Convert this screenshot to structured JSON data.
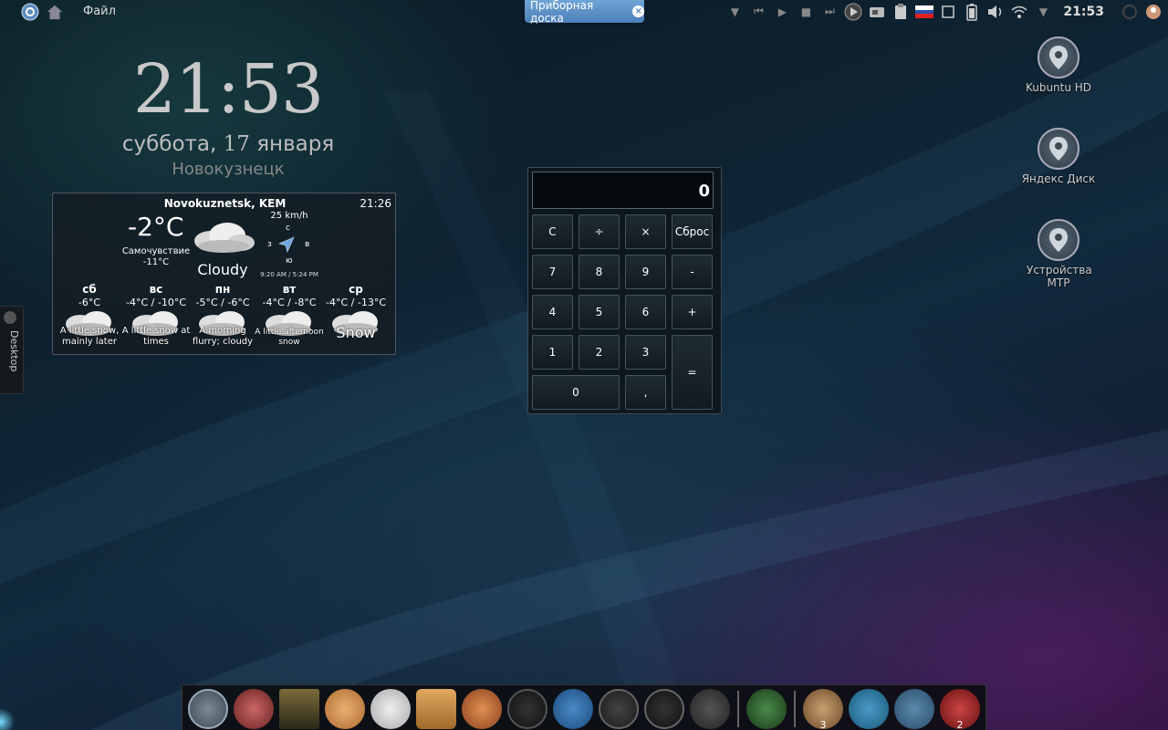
{
  "top_panel": {
    "file_menu": "Файл",
    "dashboard_tab": "Приборная доска",
    "clock": "21:53"
  },
  "desktop_clock": {
    "time": "21:53",
    "weekday": "суббота,",
    "day": "17",
    "month": "января",
    "city": "Новокузнецк"
  },
  "weather": {
    "location": "Novokuznetsk, KEM",
    "time": "21:26",
    "temperature": "-2°C",
    "feels_like_label": "Самочувствие",
    "feels_like_value": "-11°C",
    "condition": "Cloudy",
    "wind_speed": "25 km/h",
    "wind_dirs": {
      "n": "с",
      "w": "з",
      "e": "в",
      "s": "ю"
    },
    "sun_times": "9:20 AM / 5:24 PM",
    "forecast": [
      {
        "day": "сб",
        "temps": "-6°C",
        "desc": "A little snow, mainly later"
      },
      {
        "day": "вс",
        "temps": "-4°C / -10°C",
        "desc": "A little snow at times"
      },
      {
        "day": "пн",
        "temps": "-5°C / -6°C",
        "desc": "A morning flurry; cloudy"
      },
      {
        "day": "вт",
        "temps": "-4°C / -8°C",
        "desc": "A little afternoon snow"
      },
      {
        "day": "ср",
        "temps": "-4°C / -13°C",
        "desc": "Snow"
      }
    ]
  },
  "calculator": {
    "display": "0",
    "buttons": {
      "clear": "C",
      "divide": "÷",
      "multiply": "×",
      "reset": "Сброс",
      "seven": "7",
      "eight": "8",
      "nine": "9",
      "minus": "-",
      "four": "4",
      "five": "5",
      "six": "6",
      "plus": "+",
      "one": "1",
      "two": "2",
      "three": "3",
      "equals": "=",
      "zero": "0",
      "comma": ","
    }
  },
  "desktop_tab": "Desktop",
  "desktop_icons": [
    {
      "label": "Kubuntu HD"
    },
    {
      "label": "Яндекс Диск"
    },
    {
      "label": "Устройства MTP"
    }
  ],
  "dock": {
    "badge_pen": "3",
    "badge_last": "2"
  }
}
